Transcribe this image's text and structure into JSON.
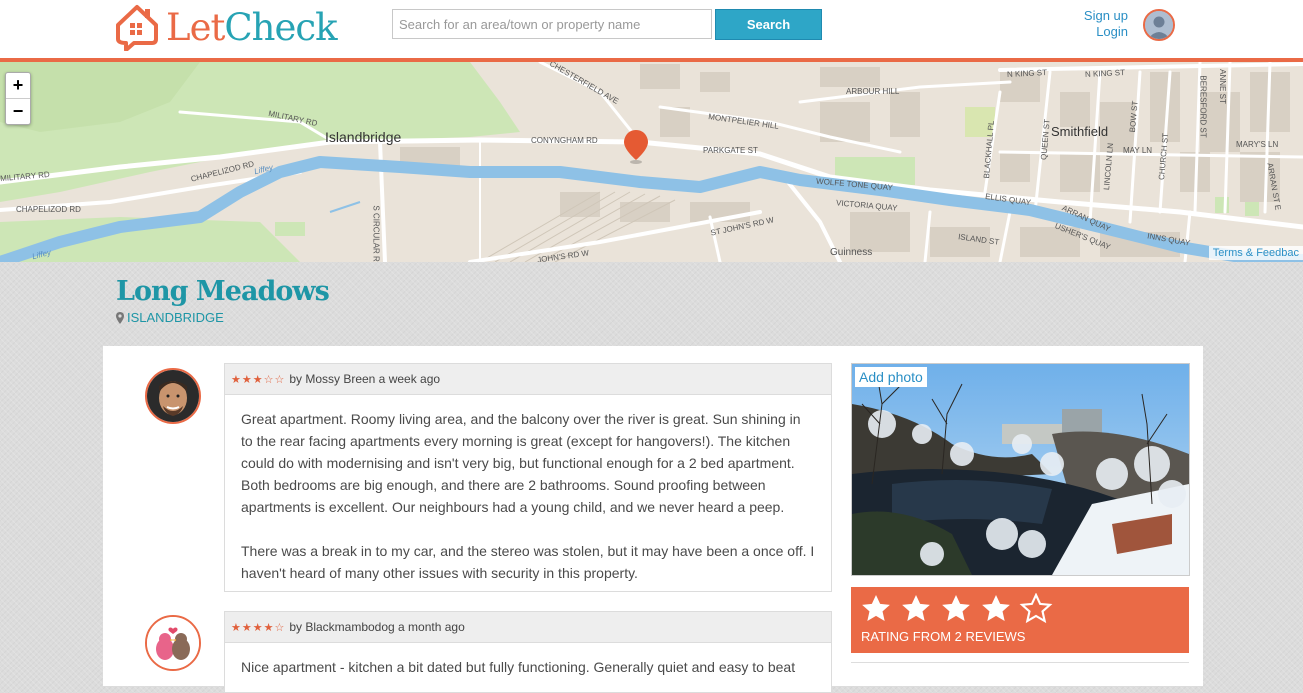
{
  "brand": {
    "name_part1": "Let",
    "name_part2": "Check",
    "accent": "#ea6a46",
    "teal": "#27a3b4"
  },
  "search": {
    "placeholder": "Search for an area/town or property name",
    "value": "",
    "button_label": "Search"
  },
  "auth": {
    "signup_label": "Sign up",
    "login_label": "Login"
  },
  "map": {
    "zoom_in": "+",
    "zoom_out": "−",
    "terms_label": "Terms & Feedbac",
    "labels": {
      "islandbridge": "Islandbridge",
      "smithfield": "Smithfield",
      "guinness": "Guinness",
      "military_rd_1": "MILITARY RD",
      "military_rd_2": "MILITARY RD",
      "chapelizod_rd_1": "CHAPELIZOD RD",
      "chapelizod_rd_2": "CHAPELIZOD RD",
      "conyngham_rd": "CONYNGHAM RD",
      "chesterfield_ave": "CHESTERFIELD AVE",
      "montpelier_hill": "MONTPELIER HILL",
      "arbour_hill": "ARBOUR HILL",
      "parkgate_st": "PARKGATE ST",
      "wolfe_tone_quay": "WOLFE TONE QUAY",
      "victoria_quay": "VICTORIA QUAY",
      "st_johns_rd_w": "ST JOHN'S RD W",
      "johns_rd_w": "JOHN'S RD W",
      "s_circular_rd": "S CIRCULAR RD",
      "n_king_st_1": "N KING ST",
      "n_king_st_2": "N KING ST",
      "ellis_quay": "ELLIS QUAY",
      "arran_quay": "ARRAN QUAY",
      "ushers_quay": "USHER'S QUAY",
      "inns_quay": "INNS QUAY",
      "island_st": "ISLAND ST",
      "blackhall_pl": "BLACKHALL PL",
      "queen_st": "QUEEN ST",
      "lincoln_ln": "LINCOLN LN",
      "bow_st": "BOW ST",
      "may_ln": "MAY LN",
      "church_st": "CHURCH ST",
      "marys_ln": "MARY'S LN",
      "beresford_st": "BERESFORD ST",
      "anne_st": "ANNE ST",
      "arran_st_e": "ARRAN ST E",
      "liffey_1": "Liffey",
      "liffey_2": "Liffey"
    }
  },
  "property": {
    "title": "Long Meadows",
    "location": "ISLANDBRIDGE"
  },
  "reviews": [
    {
      "rating": 3,
      "stars_text": "★★★☆☆",
      "byline": "by Mossy Breen a week ago",
      "paragraphs": [
        "Great apartment. Roomy living area, and the balcony over the river is great. Sun shining in to the rear facing apartments every morning is great (except for hangovers!). The kitchen could do with modernising and isn't very big, but functional enough for a 2 bed apartment. Both bedrooms are big enough, and there are 2 bathrooms. Sound proofing between apartments is excellent. Our neighbours had a young child, and we never heard a peep.",
        "There was a break in to my car, and the stereo was stolen, but it may have been a once off. I haven't heard of many other issues with security in this property."
      ]
    },
    {
      "rating": 4,
      "stars_text": "★★★★☆",
      "byline": "by Blackmambodog a month ago",
      "paragraphs": [
        "Nice apartment - kitchen a bit dated but fully functioning. Generally quiet and easy to beat"
      ]
    }
  ],
  "sidebar": {
    "add_photo_label": "Add photo",
    "overall_rating": 4,
    "rating_label": "RATING FROM 2 REVIEWS"
  }
}
